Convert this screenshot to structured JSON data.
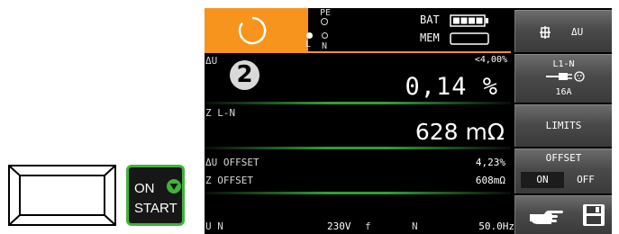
{
  "start_key": {
    "on_label": "ON",
    "start_label": "START"
  },
  "status": {
    "pe_label": "PE",
    "l_label": "L",
    "n_label": "N",
    "bat_label": "BAT",
    "mem_label": "MEM"
  },
  "results": {
    "du_label": "ΔU",
    "step_number": "2",
    "du_limit": "<4,00%",
    "du_value": "0,14  %",
    "z_label": "Z L-N",
    "z_value": "628 mΩ",
    "du_offset_label": "ΔU OFFSET",
    "du_offset_value": "4,23%",
    "z_offset_label": "Z OFFSET",
    "z_offset_value": "608mΩ",
    "u_label": "U N",
    "u_value": "230V",
    "f_label": "f",
    "n_label": "N",
    "f_value": "50.0Hz"
  },
  "softkeys": {
    "mode_label": "ΔU",
    "connection_label": "L1-N",
    "fuse_label": "16A",
    "limits_label": "LIMITS",
    "offset_label": "OFFSET",
    "offset_on": "ON",
    "offset_off": "OFF"
  },
  "colors": {
    "accent_orange": "#f7941d",
    "separator_green": "#2f9f36",
    "start_green": "#3fb43a",
    "display_bg": "#000000"
  }
}
